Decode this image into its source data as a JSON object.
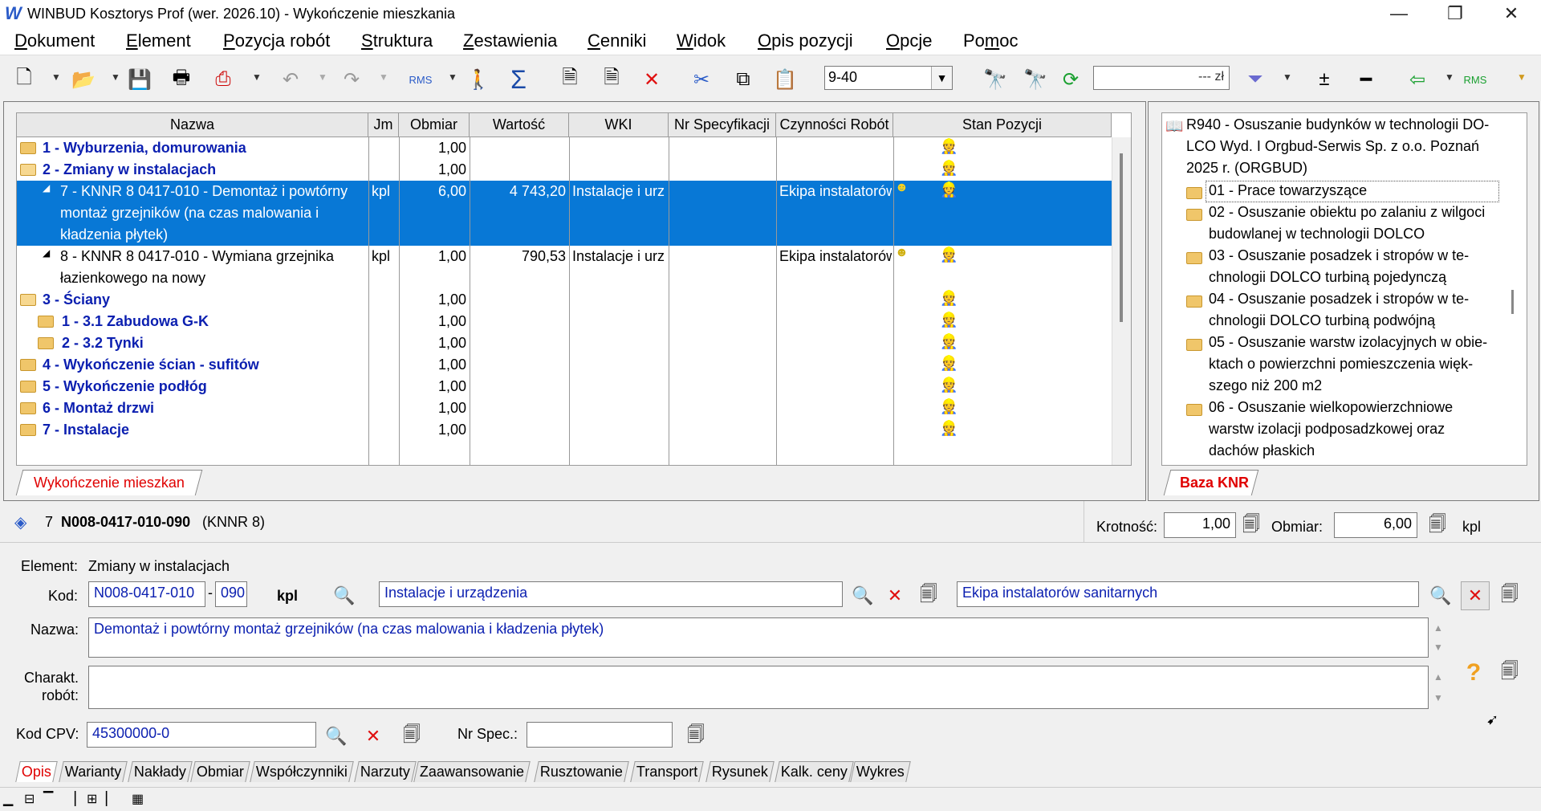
{
  "window": {
    "title": "WINBUD Kosztorys Prof (wer. 2026.10) - Wykończenie mieszkania",
    "minimize": "—",
    "maximize": "❐",
    "close": "✕"
  },
  "menu": [
    {
      "label": "Dokument",
      "ul": "D",
      "rest": "okument"
    },
    {
      "label": "Element",
      "ul": "E",
      "rest": "lement"
    },
    {
      "label": "Pozycja robót",
      "ul": "P",
      "rest": "ozycja robót"
    },
    {
      "label": "Struktura",
      "ul": "S",
      "rest": "truktura"
    },
    {
      "label": "Zestawienia",
      "ul": "Z",
      "rest": "estawienia"
    },
    {
      "label": "Cenniki",
      "ul": "C",
      "rest": "enniki"
    },
    {
      "label": "Widok",
      "ul": "W",
      "rest": "idok"
    },
    {
      "label": "Opis pozycji",
      "ul": "O",
      "rest": "pis pozycji"
    },
    {
      "label": "Opcje",
      "ul": "O",
      "rest": "pcje"
    },
    {
      "label": "Pomoc",
      "pre": "Po",
      "ul": "m",
      "rest": "oc"
    }
  ],
  "toolbar": {
    "combo_value": "9-40",
    "price_value": "--- zł",
    "rms_label": "RMS"
  },
  "tree": {
    "columns": [
      "Nazwa",
      "Jm",
      "Obmiar",
      "Wartość",
      "WKI",
      "Nr Specyfikacji",
      "Czynności Robót",
      "Stan Pozycji"
    ],
    "rows": [
      {
        "name": "1 - Wyburzenia, domurowania",
        "obmiar": "1,00"
      },
      {
        "name": "2 - Zmiany w instalacjach",
        "obmiar": "1,00"
      },
      {
        "name_l1": "7 - KNNR 8 0417-010 - Demontaż i powtórny",
        "name_l2": "montaż grzejników (na czas malowania i",
        "name_l3": "kładzenia płytek)",
        "jm": "kpl",
        "obmiar": "6,00",
        "wartosc": "4 743,20",
        "wki": "Instalacje i urz",
        "czynnosci": "Ekipa instalatorów"
      },
      {
        "name_l1": "8 - KNNR 8 0417-010 - Wymiana grzejnika",
        "name_l2": "łazienkowego na nowy",
        "jm": "kpl",
        "obmiar": "1,00",
        "wartosc": "790,53",
        "wki": "Instalacje i urz",
        "czynnosci": "Ekipa instalatorów"
      },
      {
        "name": "3 - Ściany",
        "obmiar": "1,00"
      },
      {
        "name": "1 - 3.1 Zabudowa G-K",
        "obmiar": "1,00"
      },
      {
        "name": "2 - 3.2 Tynki",
        "obmiar": "1,00"
      },
      {
        "name": "4 - Wykończenie ścian - sufitów",
        "obmiar": "1,00"
      },
      {
        "name": "5 - Wykończenie podłóg",
        "obmiar": "1,00"
      },
      {
        "name": "6 - Montaż drzwi",
        "obmiar": "1,00"
      },
      {
        "name": "7 - Instalacje",
        "obmiar": "1,00"
      }
    ],
    "tab": "Wykończenie mieszkan"
  },
  "knr": {
    "header_l1": "R940 - Osuszanie budynków w technologii DO-",
    "header_l2": "LCO Wyd. I Orgbud-Serwis Sp. z o.o. Poznań",
    "header_l3": "2025 r. (ORGBUD)",
    "items": [
      {
        "l1": "01 - Prace towarzyszące"
      },
      {
        "l1": "02 - Osuszanie obiektu po zalaniu z wilgoci",
        "l2": "budowlanej w technologii DOLCO"
      },
      {
        "l1": "03 - Osuszanie posadzek i stropów w te-",
        "l2": "chnologii DOLCO turbiną pojedynczą"
      },
      {
        "l1": "04 - Osuszanie posadzek i stropów w te-",
        "l2": "chnologii DOLCO turbiną podwójną"
      },
      {
        "l1": "05 - Osuszanie warstw izolacyjnych w obie-",
        "l2": "ktach o powierzchni pomieszczenia więk-",
        "l3": "szego niż 200 m2"
      },
      {
        "l1": "06 - Osuszanie wielkopowierzchniowe",
        "l2": "warstw izolacji podposadzkowej oraz",
        "l3": "dachów płaskich"
      }
    ],
    "tab": "Baza KNR"
  },
  "detail": {
    "pos_no": "7",
    "code_full": "N008-0417-010-090",
    "catalog": "(KNNR 8)",
    "krotnosc_label": "Krotność:",
    "krotnosc": "1,00",
    "obmiar_label": "Obmiar:",
    "obmiar": "6,00",
    "unit": "kpl",
    "element_label": "Element:",
    "element": "Zmiany w instalacjach",
    "kod_label": "Kod:",
    "kod1": "N008-0417-010",
    "kod_sep": "-",
    "kod2": "090",
    "kod_unit": "kpl",
    "wki": "Instalacje i urządzenia",
    "ekipa": "Ekipa instalatorów sanitarnych",
    "nazwa_label": "Nazwa:",
    "nazwa": "Demontaż i powtórny montaż grzejników (na czas malowania i kładzenia płytek)",
    "charakt_label1": "Charakt.",
    "charakt_label2": "robót:",
    "charakt": "",
    "cpv_label": "Kod CPV:",
    "cpv": "45300000-0",
    "nrspec_label": "Nr Spec.:",
    "nrspec": ""
  },
  "bottom_tabs": [
    "Opis",
    "Warianty",
    "Nakłady",
    "Obmiar",
    "Współczynniki",
    "Narzuty",
    "Zaawansowanie",
    "Rusztowanie",
    "Transport",
    "Rysunek",
    "Kalk. ceny",
    "Wykres"
  ],
  "colors": {
    "selection": "#0878d6",
    "group_text": "#0b1fb0",
    "tab_text": "#e00000"
  }
}
